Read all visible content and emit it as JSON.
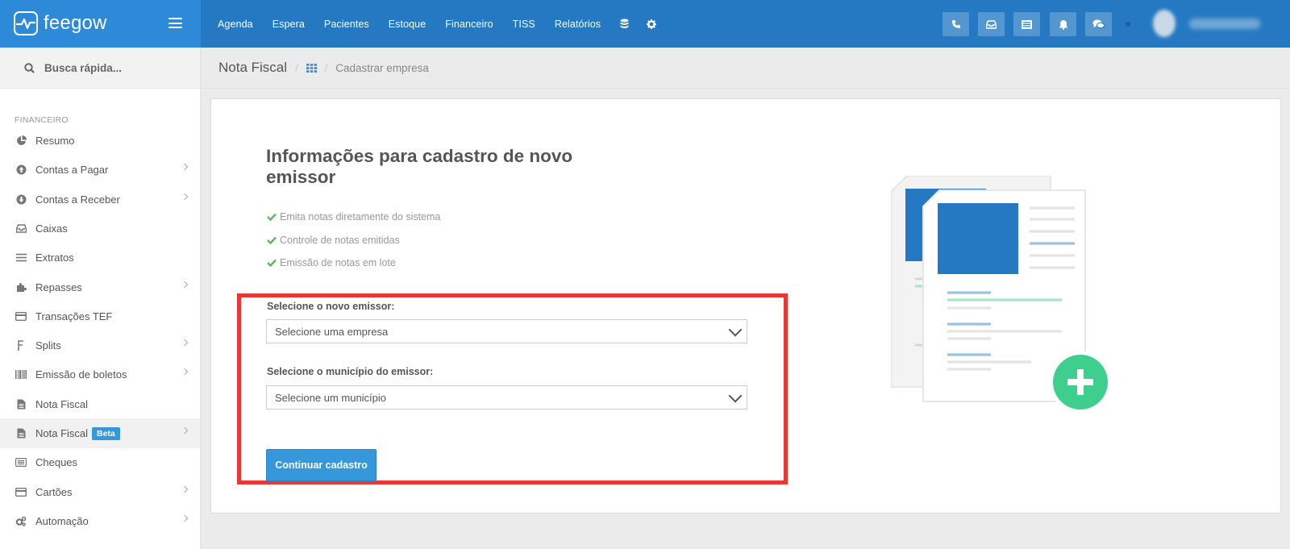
{
  "brand": {
    "name": "feegow"
  },
  "topnav": {
    "items": [
      "Agenda",
      "Espera",
      "Pacientes",
      "Estoque",
      "Financeiro",
      "TISS",
      "Relatórios"
    ],
    "icons": [
      "database-icon",
      "gear-icon"
    ]
  },
  "toolbar": {
    "buttons": [
      "phone-icon",
      "inbox-icon",
      "list-icon",
      "bell-icon",
      "chat-icon"
    ]
  },
  "search": {
    "placeholder": "Busca rápida..."
  },
  "sidebar": {
    "section": "FINANCEIRO",
    "items": [
      {
        "label": "Resumo",
        "icon": "pie-chart-icon",
        "chevron": false
      },
      {
        "label": "Contas a Pagar",
        "icon": "arrow-up-circle-icon",
        "chevron": true
      },
      {
        "label": "Contas a Receber",
        "icon": "arrow-down-circle-icon",
        "chevron": true
      },
      {
        "label": "Caixas",
        "icon": "inbox-icon",
        "chevron": false
      },
      {
        "label": "Extratos",
        "icon": "list-icon",
        "chevron": false
      },
      {
        "label": "Repasses",
        "icon": "puzzle-icon",
        "chevron": true
      },
      {
        "label": "Transações TEF",
        "icon": "credit-card-icon",
        "chevron": false
      },
      {
        "label": "Splits",
        "icon": "split-icon",
        "chevron": true
      },
      {
        "label": "Emissão de boletos",
        "icon": "barcode-icon",
        "chevron": true
      },
      {
        "label": "Nota Fiscal",
        "icon": "file-icon",
        "chevron": false
      },
      {
        "label": "Nota Fiscal",
        "icon": "file-icon",
        "chevron": true,
        "badge": "Beta",
        "active": true
      },
      {
        "label": "Cheques",
        "icon": "check-list-icon",
        "chevron": false
      },
      {
        "label": "Cartões",
        "icon": "credit-card-icon",
        "chevron": true
      },
      {
        "label": "Automação",
        "icon": "cogs-icon",
        "chevron": true
      }
    ]
  },
  "breadcrumb": {
    "title": "Nota Fiscal",
    "separator": "/",
    "current": "Cadastrar empresa"
  },
  "main": {
    "heading": "Informações para cadastro de novo emissor",
    "features": [
      "Emita notas diretamente do sistema",
      "Controle de notas emitidas",
      "Emissão de notas em lote"
    ],
    "emissor_label": "Selecione o novo emissor:",
    "emissor_value": "Selecione uma empresa",
    "municipio_label": "Selecione o município do emissor:",
    "municipio_value": "Selecione um município",
    "continue_label": "Continuar cadastro"
  },
  "colors": {
    "topbar": "#2579c2",
    "accent": "#3498db",
    "check": "#5cb85c",
    "highlight": "#e53935",
    "plus": "#3ecf8e"
  }
}
